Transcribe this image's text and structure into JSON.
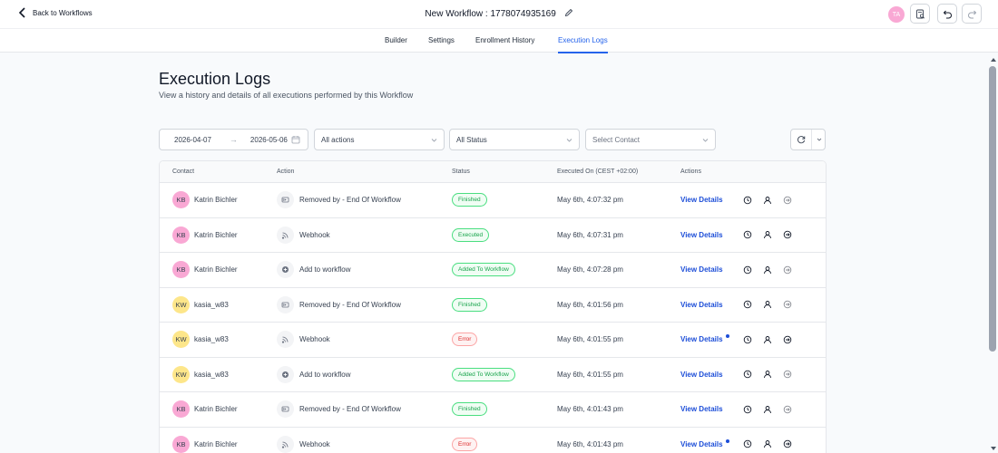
{
  "header": {
    "back_label": "Back to Workflows",
    "workflow_title": "New Workflow : 1778074935169",
    "user_initials": "TA"
  },
  "tabs": [
    {
      "label": "Builder"
    },
    {
      "label": "Settings"
    },
    {
      "label": "Enrollment History"
    },
    {
      "label": "Execution Logs",
      "active": true
    }
  ],
  "page": {
    "title": "Execution Logs",
    "subtitle": "View a history and details of all executions performed by this Workflow"
  },
  "filters": {
    "date_from": "2026-04-07",
    "date_to": "2026-05-06",
    "actions": "All actions",
    "status": "All Status",
    "contact_placeholder": "Select Contact"
  },
  "table": {
    "columns": [
      "Contact",
      "Action",
      "Status",
      "Executed On (CEST +02:00)",
      "Actions"
    ],
    "view_label": "View Details",
    "rows": [
      {
        "initials": "KB",
        "contact": "Katrin Bichler",
        "avatar_color": "#f9a8d4",
        "action": "Removed by - End Of Workflow",
        "action_icon": "end-workflow-icon",
        "status": "Finished",
        "status_color": "green",
        "executed": "May 6th, 4:07:32 pm",
        "dot": false,
        "exit_active": false
      },
      {
        "initials": "KB",
        "contact": "Katrin Bichler",
        "avatar_color": "#f9a8d4",
        "action": "Webhook",
        "action_icon": "webhook-icon",
        "status": "Executed",
        "status_color": "green",
        "executed": "May 6th, 4:07:31 pm",
        "dot": false,
        "exit_active": true
      },
      {
        "initials": "KB",
        "contact": "Katrin Bichler",
        "avatar_color": "#f9a8d4",
        "action": "Add to workflow",
        "action_icon": "add-workflow-icon",
        "status": "Added To Workflow",
        "status_color": "green",
        "executed": "May 6th, 4:07:28 pm",
        "dot": false,
        "exit_active": false
      },
      {
        "initials": "KW",
        "contact": "kasia_w83",
        "avatar_color": "#fde68a",
        "action": "Removed by - End Of Workflow",
        "action_icon": "end-workflow-icon",
        "status": "Finished",
        "status_color": "green",
        "executed": "May 6th, 4:01:56 pm",
        "dot": false,
        "exit_active": false
      },
      {
        "initials": "KW",
        "contact": "kasia_w83",
        "avatar_color": "#fde68a",
        "action": "Webhook",
        "action_icon": "webhook-icon",
        "status": "Error",
        "status_color": "red",
        "executed": "May 6th, 4:01:55 pm",
        "dot": true,
        "exit_active": true
      },
      {
        "initials": "KW",
        "contact": "kasia_w83",
        "avatar_color": "#fde68a",
        "action": "Add to workflow",
        "action_icon": "add-workflow-icon",
        "status": "Added To Workflow",
        "status_color": "green",
        "executed": "May 6th, 4:01:55 pm",
        "dot": false,
        "exit_active": false
      },
      {
        "initials": "KB",
        "contact": "Katrin Bichler",
        "avatar_color": "#f9a8d4",
        "action": "Removed by - End Of Workflow",
        "action_icon": "end-workflow-icon",
        "status": "Finished",
        "status_color": "green",
        "executed": "May 6th, 4:01:43 pm",
        "dot": false,
        "exit_active": false
      },
      {
        "initials": "KB",
        "contact": "Katrin Bichler",
        "avatar_color": "#f9a8d4",
        "action": "Webhook",
        "action_icon": "webhook-icon",
        "status": "Error",
        "status_color": "red",
        "executed": "May 6th, 4:01:43 pm",
        "dot": true,
        "exit_active": true
      }
    ]
  },
  "colors": {
    "accent": "#2563eb",
    "link": "#1d4ed8",
    "status_green": "#16a34a",
    "status_red": "#dc2626"
  }
}
